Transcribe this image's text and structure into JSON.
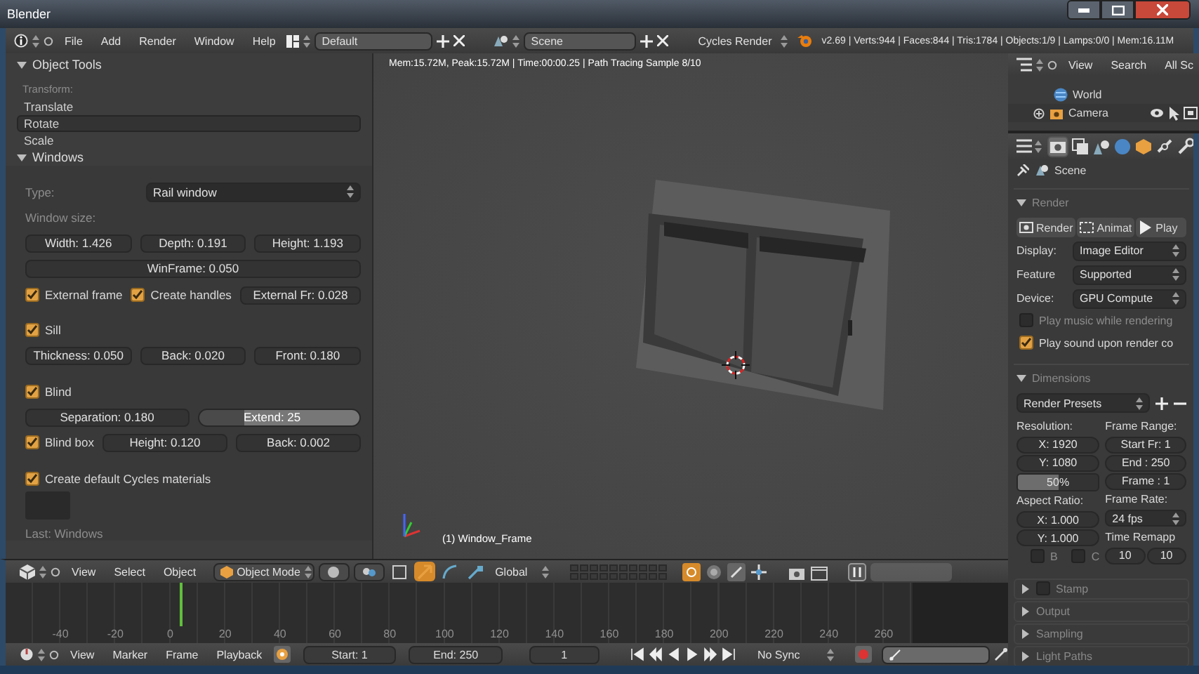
{
  "window": {
    "title": "Blender"
  },
  "top_bar": {
    "menus": [
      "File",
      "Add",
      "Render",
      "Window",
      "Help"
    ],
    "layout": "Default",
    "scene": "Scene",
    "engine": "Cycles Render",
    "stats": "v2.69 | Verts:944 | Faces:844 | Tris:1784 | Objects:1/9 | Lamps:0/0 | Mem:16.11M"
  },
  "tool_panel": {
    "object_tools": {
      "title": "Object Tools",
      "expanded": true,
      "section": "Transform:",
      "items": [
        {
          "label": "Translate",
          "selected": false
        },
        {
          "label": "Rotate",
          "selected": true
        },
        {
          "label": "Scale",
          "selected": false
        }
      ]
    },
    "windows": {
      "title": "Windows",
      "expanded": true,
      "type_label": "Type:",
      "type_value": "Rail window",
      "size_label": "Window size:",
      "size_fields": [
        "Width: 1.426",
        "Depth: 0.191",
        "Height: 1.193"
      ],
      "winframe": "WinFrame: 0.050",
      "rows": [
        [
          {
            "kind": "check",
            "label": "External frame",
            "checked": true
          },
          {
            "kind": "check",
            "label": "Create handles",
            "checked": true
          },
          {
            "kind": "number",
            "text": "External Fr: 0.028"
          }
        ],
        [
          {
            "kind": "check",
            "label": "Sill",
            "checked": true
          }
        ],
        [
          {
            "kind": "number",
            "text": "Thickness: 0.050"
          },
          {
            "kind": "number",
            "text": "Back: 0.020"
          },
          {
            "kind": "number",
            "text": "Front: 0.180"
          }
        ],
        [
          {
            "kind": "check",
            "label": "Blind",
            "checked": true
          }
        ],
        [
          {
            "kind": "number",
            "text": "Separation: 0.180"
          },
          {
            "kind": "active",
            "text": "Extend: 25"
          }
        ],
        [
          {
            "kind": "check",
            "label": "Blind box",
            "checked": true
          },
          {
            "kind": "number",
            "text": "Height: 0.120"
          },
          {
            "kind": "number",
            "text": "Back: 0.002"
          }
        ],
        [
          {
            "kind": "check",
            "label": "Create default Cycles materials",
            "checked": true
          }
        ]
      ],
      "last": "Last: Windows"
    }
  },
  "viewport": {
    "info": "Mem:15.72M, Peak:15.72M | Time:00:00.25 | Path Tracing Sample 8/10",
    "object_label": "(1) Window_Frame"
  },
  "view3d_header": {
    "menus": [
      "View",
      "Select",
      "Object"
    ],
    "mode": "Object Mode",
    "orientation": "Global",
    "manipulators": [
      {
        "kind": "widget",
        "selected": false
      },
      {
        "kind": "translate",
        "selected": true
      },
      {
        "kind": "rotate",
        "selected": false
      },
      {
        "kind": "scale",
        "selected": false
      }
    ]
  },
  "timeline": {
    "ruler": [
      "-40",
      "-20",
      "0",
      "20",
      "40",
      "60",
      "80",
      "100",
      "120",
      "140",
      "160",
      "180",
      "200",
      "220",
      "240",
      "260"
    ]
  },
  "timeline_header": {
    "menus": [
      "View",
      "Marker",
      "Frame",
      "Playback"
    ],
    "start": "Start: 1",
    "end": "End: 250",
    "current": "1",
    "sync": "No Sync"
  },
  "outliner": {
    "menus": [
      "View",
      "Search",
      "All Sc"
    ],
    "items": [
      {
        "label": "World",
        "kind": "world"
      },
      {
        "label": "Camera",
        "kind": "camera"
      }
    ]
  },
  "properties": {
    "tabs": [
      {
        "kind": "render",
        "selected": true
      },
      {
        "kind": "layers",
        "selected": false
      },
      {
        "kind": "scene",
        "selected": false
      },
      {
        "kind": "world",
        "selected": false
      },
      {
        "kind": "object",
        "selected": false
      },
      {
        "kind": "constraints",
        "selected": false
      },
      {
        "kind": "modifiers",
        "selected": false
      }
    ],
    "context": "Scene",
    "render": {
      "title": "Render",
      "expanded": true,
      "buttons": [
        {
          "label": "Render",
          "kind": "still"
        },
        {
          "label": "Animat",
          "kind": "animation"
        },
        {
          "label": "Play",
          "kind": "play"
        }
      ],
      "selects": [
        {
          "label": "Display:",
          "value": "Image Editor"
        },
        {
          "label": "Feature",
          "value": "Supported"
        },
        {
          "label": "Device:",
          "value": "GPU Compute"
        }
      ],
      "checks": [
        {
          "label": "Play music while rendering",
          "checked": false
        },
        {
          "label": "Play sound upon render co",
          "checked": true
        }
      ]
    },
    "dimensions": {
      "title": "Dimensions",
      "expanded": true,
      "presets": "Render Presets",
      "resolution_label": "Resolution:",
      "res_x": "X: 1920",
      "res_y": "Y: 1080",
      "percentage": {
        "text": "50%",
        "level": 0.5
      },
      "aspect_label": "Aspect Ratio:",
      "aspect_x": "X: 1.000",
      "aspect_y": "Y: 1.000",
      "toggles": [
        {
          "label": "B",
          "checked": false
        },
        {
          "label": "C",
          "checked": false
        }
      ],
      "range_label": "Frame Range:",
      "start": "Start Fr: 1",
      "end": "End : 250",
      "frame": "Frame : 1",
      "rate_label": "Frame Rate:",
      "rate": "24 fps",
      "remap_label": "Time Remapp",
      "remap": [
        "10",
        "10"
      ]
    },
    "panels": [
      {
        "title": "Stamp",
        "kind": "toggle",
        "expanded": false,
        "checked": false
      },
      {
        "title": "Output",
        "kind": "plain",
        "expanded": false
      },
      {
        "title": "Sampling",
        "kind": "plain",
        "expanded": false
      },
      {
        "title": "Light Paths",
        "kind": "plain",
        "expanded": false
      }
    ]
  }
}
